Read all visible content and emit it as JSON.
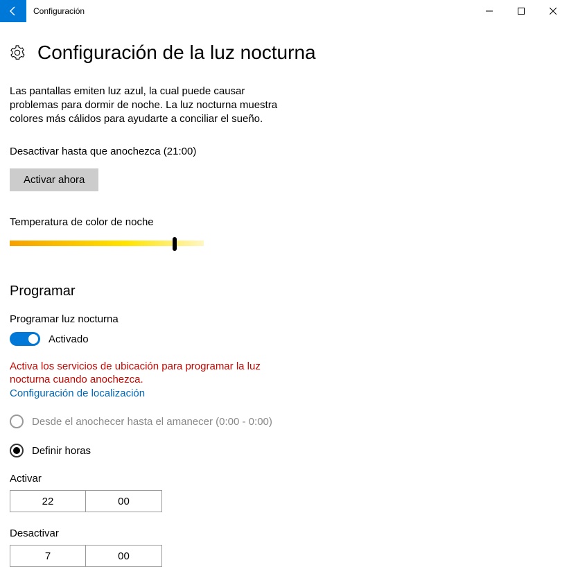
{
  "titlebar": {
    "title": "Configuración"
  },
  "page": {
    "title": "Configuración de la luz nocturna",
    "description": "Las pantallas emiten luz azul, la cual puede causar problemas para dormir de noche. La luz nocturna muestra colores más cálidos para ayudarte a conciliar el sueño.",
    "status_line": "Desactivar hasta que anochezca (21:00)",
    "activate_button": "Activar ahora",
    "temp_label": "Temperatura de color de noche",
    "slider_percent": 85
  },
  "schedule": {
    "heading": "Programar",
    "toggle_label": "Programar luz nocturna",
    "toggle_state": "Activado",
    "warning": "Activa los servicios de ubicación para programar la luz nocturna cuando anochezca.",
    "link": "Configuración de localización",
    "option_sunset": "Desde el anochecer hasta el amanecer (0:00 - 0:00)",
    "option_hours": "Definir horas",
    "on_label": "Activar",
    "on_hour": "22",
    "on_min": "00",
    "off_label": "Desactivar",
    "off_hour": "7",
    "off_min": "00"
  }
}
